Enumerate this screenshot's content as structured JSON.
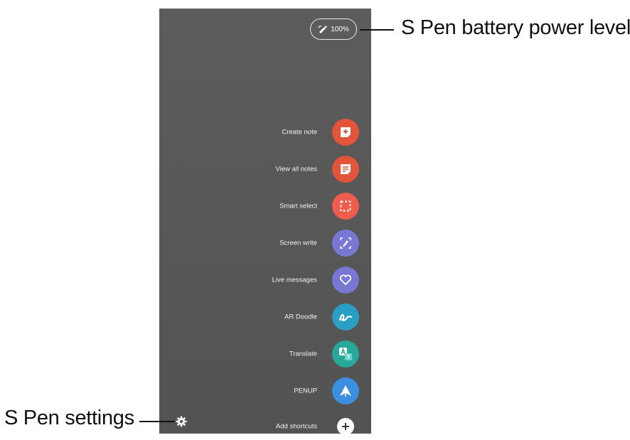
{
  "battery": {
    "level_label": "100%",
    "icon": "s-pen-icon"
  },
  "menu": {
    "items": [
      {
        "label": "Create note",
        "icon": "create-note-icon",
        "color": "#e4543a"
      },
      {
        "label": "View all notes",
        "icon": "view-notes-icon",
        "color": "#e4543a"
      },
      {
        "label": "Smart select",
        "icon": "smart-select-icon",
        "color": "#ef5b4c"
      },
      {
        "label": "Screen write",
        "icon": "screen-write-icon",
        "color": "#7878d4"
      },
      {
        "label": "Live messages",
        "icon": "live-messages-icon",
        "color": "#7878d4"
      },
      {
        "label": "AR Doodle",
        "icon": "ar-doodle-icon",
        "color": "#2a9fc4"
      },
      {
        "label": "Translate",
        "icon": "translate-icon",
        "color": "#27a89b"
      },
      {
        "label": "PENUP",
        "icon": "penup-icon",
        "color": "#3b8fe0"
      },
      {
        "label": "Add shortcuts",
        "icon": "add-icon",
        "color": "#ffffff"
      }
    ]
  },
  "settings": {
    "icon": "gear-icon"
  },
  "callouts": {
    "battery": "S Pen battery power level",
    "settings": "S Pen settings"
  }
}
